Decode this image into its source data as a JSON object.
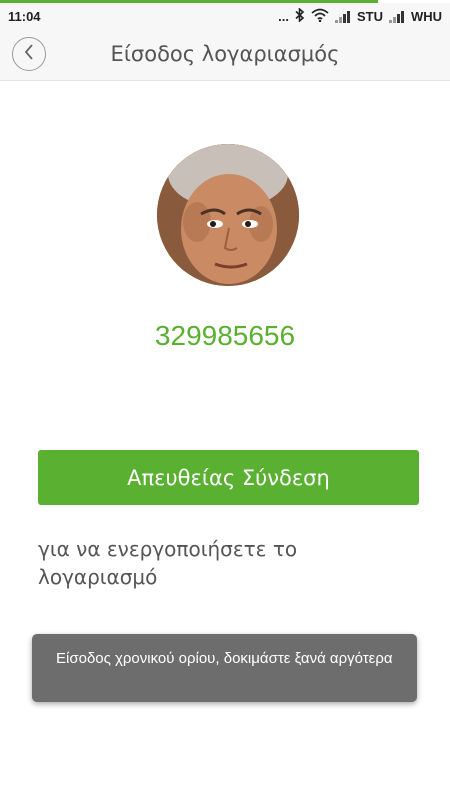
{
  "status_bar": {
    "time": "11:04",
    "dots": "...",
    "carrier1": "STU",
    "carrier2": "WHU",
    "icons": [
      "bluetooth-icon",
      "wifi-icon",
      "signal-icon",
      "signal-icon"
    ]
  },
  "header": {
    "title": "Είσοδος λογαριασμός",
    "back_icon": "chevron-left-icon"
  },
  "profile": {
    "account_number": "329985656"
  },
  "login_button": {
    "label": "Απευθείας Σύνδεση"
  },
  "hint": "για να ενεργοποιήσετε το λογαριασμό",
  "toast": {
    "message": "Είσοδος χρονικού ορίου, δοκιμάστε ξανά αργότερα"
  },
  "colors": {
    "accent": "#5ab031",
    "toast_bg": "#6d6d6d"
  }
}
